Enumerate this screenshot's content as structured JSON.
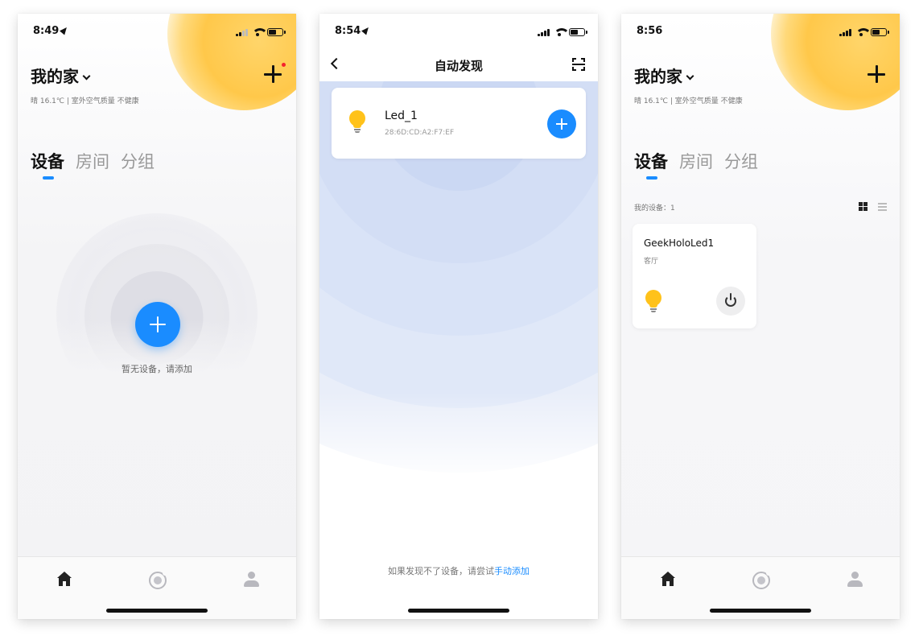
{
  "phone1": {
    "status": {
      "time": "8:49"
    },
    "home": {
      "title": "我的家",
      "weather": "晴 16.1℃  |  室外空气质量 不健康"
    },
    "tabs": [
      "设备",
      "房间",
      "分组"
    ],
    "empty": {
      "text": "暂无设备，请添加"
    }
  },
  "phone2": {
    "status": {
      "time": "8:54"
    },
    "header": {
      "title": "自动发现"
    },
    "device": {
      "name": "Led_1",
      "mac": "28:6D:CD:A2:F7:EF"
    },
    "hint": {
      "prefix": "如果发现不了设备，请尝试",
      "link": "手动添加"
    }
  },
  "phone3": {
    "status": {
      "time": "8:56"
    },
    "home": {
      "title": "我的家",
      "weather": "晴 16.1℃  |  室外空气质量 不健康"
    },
    "tabs": [
      "设备",
      "房间",
      "分组"
    ],
    "list": {
      "count_label": "我的设备：1"
    },
    "devices": [
      {
        "name": "GeekHoloLed1",
        "room": "客厅"
      }
    ]
  },
  "colors": {
    "accent": "#1a8cff",
    "sun": "#ffc84a",
    "bulb": "#ffc21a",
    "badge": "#f5222d"
  },
  "icons": [
    "location-arrow-icon",
    "signal-icon",
    "wifi-icon",
    "battery-icon",
    "chevron-down-icon",
    "plus-icon",
    "home-icon",
    "smart-icon",
    "profile-icon",
    "back-icon",
    "scan-icon",
    "bulb-icon",
    "power-icon",
    "grid-view-icon",
    "list-view-icon"
  ]
}
